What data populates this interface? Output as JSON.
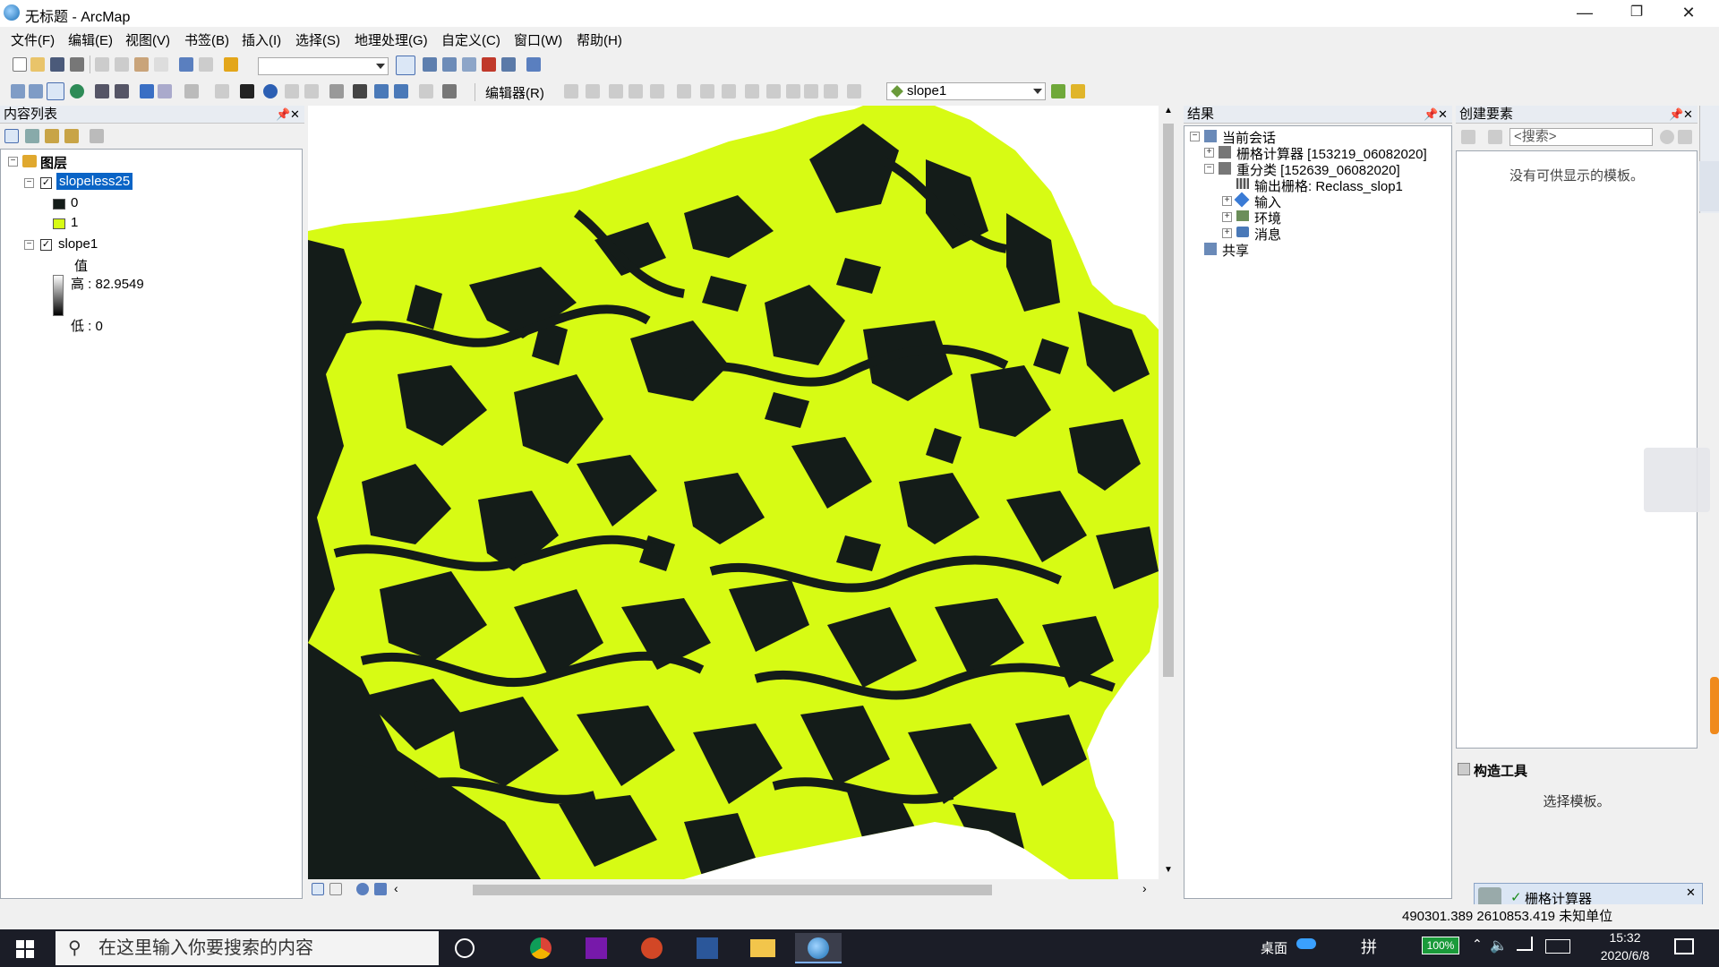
{
  "window": {
    "title": "无标题 - ArcMap",
    "minimize": "—",
    "restore": "❐",
    "close": "✕"
  },
  "menu": [
    "文件(F)",
    "编辑(E)",
    "视图(V)",
    "书签(B)",
    "插入(I)",
    "选择(S)",
    "地理处理(G)",
    "自定义(C)",
    "窗口(W)",
    "帮助(H)"
  ],
  "toolbar2": {
    "editor_label": "编辑器(R)",
    "layer_combo": "slope1"
  },
  "toc": {
    "title": "内容列表",
    "root": "图层",
    "layers": [
      {
        "name": "slopeless25",
        "classes": [
          "0",
          "1"
        ]
      },
      {
        "name": "slope1",
        "legend_title": "值",
        "high": "高 : 82.9549",
        "low": "低 : 0"
      }
    ]
  },
  "results": {
    "title": "结果",
    "current_session": "当前会话",
    "items": [
      "栅格计算器 [153219_06082020]",
      "重分类 [152639_06082020]"
    ],
    "reclass_children": [
      "输出栅格: Reclass_slop1",
      "输入",
      "环境",
      "消息"
    ],
    "shared": "共享"
  },
  "create_features": {
    "title": "创建要素",
    "search_placeholder": "<搜索>",
    "empty_text": "没有可供显示的模板。",
    "construct_title": "构造工具",
    "construct_text": "选择模板。"
  },
  "notification": {
    "text": "栅格计算器"
  },
  "status": {
    "coords": "490301.389  2610853.419 未知单位"
  },
  "taskbar": {
    "search_placeholder": "在这里输入你要搜索的内容",
    "desktop": "桌面",
    "ime": "拼",
    "battery": "100%",
    "time": "15:32",
    "date": "2020/6/8"
  },
  "colors": {
    "raster_class_1": "#d7fb14",
    "raster_class_0": "#141c19",
    "selection": "#0a64c6"
  }
}
